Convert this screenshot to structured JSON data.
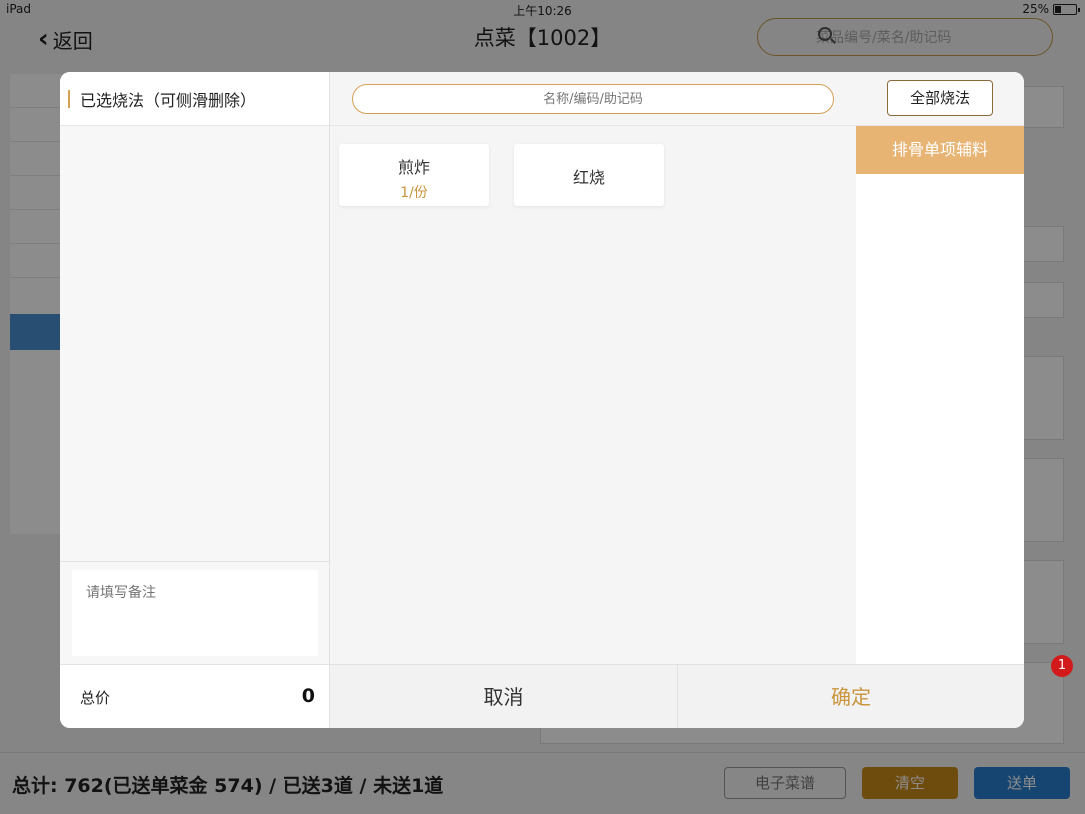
{
  "status_bar": {
    "device": "iPad",
    "time": "上午10:26",
    "battery": "25%"
  },
  "nav": {
    "back_label": "返回",
    "title": "点菜【1002】",
    "search_placeholder": "菜品编号/菜名/助记码"
  },
  "modal": {
    "left_header": "已选烧法（可侧滑删除）",
    "remark_placeholder": "请填写备注",
    "search_placeholder": "名称/编码/助记码",
    "all_methods_label": "全部烧法",
    "methods": [
      {
        "name": "煎炸",
        "qty": "1/份"
      },
      {
        "name": "红烧",
        "qty": ""
      }
    ],
    "right_tab": "排骨单项辅料",
    "total_label": "总价",
    "total_value": "0",
    "cancel_label": "取消",
    "confirm_label": "确定"
  },
  "bottom": {
    "summary": "总计: 762(已送单菜金 574) / 已送3道 / 未送1道",
    "menu_label": "电子菜谱",
    "clear_label": "清空",
    "send_label": "送单",
    "badge": "1"
  }
}
